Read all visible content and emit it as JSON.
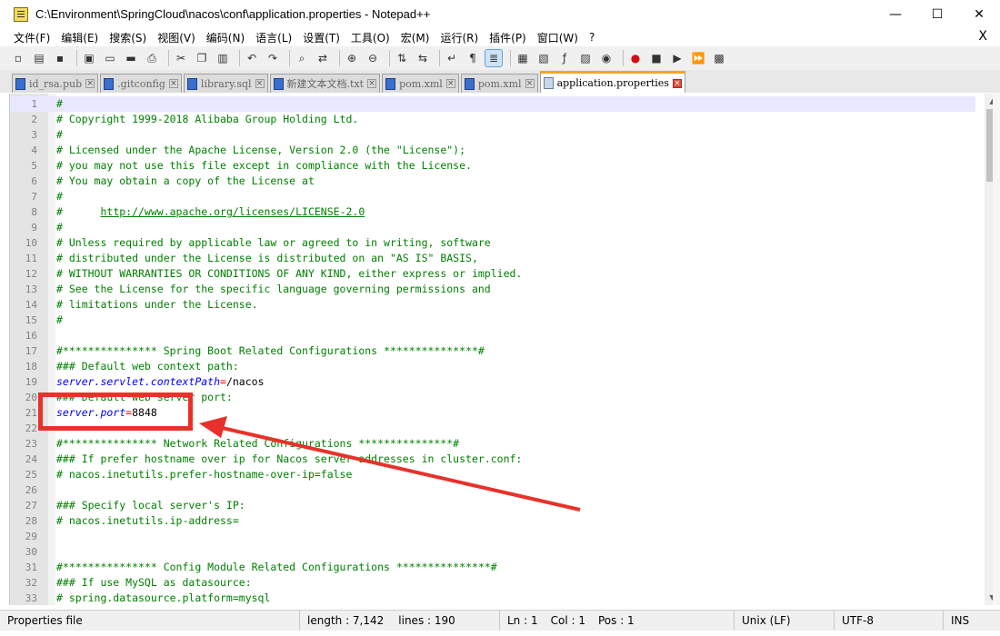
{
  "window": {
    "title": "C:\\Environment\\SpringCloud\\nacos\\conf\\application.properties - Notepad++",
    "minimize": "—",
    "maximize": "☐",
    "close": "✕"
  },
  "menu": {
    "items": [
      "文件(F)",
      "编辑(E)",
      "搜索(S)",
      "视图(V)",
      "编码(N)",
      "语言(L)",
      "设置(T)",
      "工具(O)",
      "宏(M)",
      "运行(R)",
      "插件(P)",
      "窗口(W)",
      "?"
    ],
    "close": "X"
  },
  "toolbar": {
    "buttons": [
      "new-icon",
      "open-icon",
      "save-icon",
      "save-all-icon",
      "close-icon",
      "close-all-icon",
      "print-icon",
      "cut-icon",
      "copy-icon",
      "paste-icon",
      "undo-icon",
      "redo-icon",
      "find-icon",
      "replace-icon",
      "zoom-in-icon",
      "zoom-out-icon",
      "sync-v-icon",
      "sync-h-icon",
      "wrap-icon",
      "all-chars-icon",
      "indent-guide-icon",
      "udl-icon",
      "doc-map-icon",
      "function-list-icon",
      "folder-workspace-icon",
      "monitor-icon",
      "record-macro-icon",
      "stop-macro-icon",
      "play-macro-icon",
      "play-multi-icon",
      "save-macro-icon"
    ]
  },
  "tabs": [
    {
      "label": "id_rsa.pub",
      "active": false
    },
    {
      "label": ".gitconfig",
      "active": false
    },
    {
      "label": "library.sql",
      "active": false
    },
    {
      "label": "新建文本文档.txt",
      "active": false
    },
    {
      "label": "pom.xml",
      "active": false
    },
    {
      "label": "pom.xml",
      "active": false
    },
    {
      "label": "application.properties",
      "active": true
    }
  ],
  "editor": {
    "lines": [
      {
        "n": "1",
        "segs": [
          [
            "c",
            "#"
          ]
        ]
      },
      {
        "n": "2",
        "segs": [
          [
            "c",
            "# Copyright 1999-2018 Alibaba Group Holding Ltd."
          ]
        ]
      },
      {
        "n": "3",
        "segs": [
          [
            "c",
            "#"
          ]
        ]
      },
      {
        "n": "4",
        "segs": [
          [
            "c",
            "# Licensed under the Apache License, Version 2.0 (the \"License\");"
          ]
        ]
      },
      {
        "n": "5",
        "segs": [
          [
            "c",
            "# you may not use this file except in compliance with the License."
          ]
        ]
      },
      {
        "n": "6",
        "segs": [
          [
            "c",
            "# You may obtain a copy of the License at"
          ]
        ]
      },
      {
        "n": "7",
        "segs": [
          [
            "c",
            "#"
          ]
        ]
      },
      {
        "n": "8",
        "segs": [
          [
            "c",
            "#      "
          ],
          [
            "u",
            "http://www.apache.org/licenses/LICENSE-2.0"
          ]
        ]
      },
      {
        "n": "9",
        "segs": [
          [
            "c",
            "#"
          ]
        ]
      },
      {
        "n": "10",
        "segs": [
          [
            "c",
            "# Unless required by applicable law or agreed to in writing, software"
          ]
        ]
      },
      {
        "n": "11",
        "segs": [
          [
            "c",
            "# distributed under the License is distributed on an \"AS IS\" BASIS,"
          ]
        ]
      },
      {
        "n": "12",
        "segs": [
          [
            "c",
            "# WITHOUT WARRANTIES OR CONDITIONS OF ANY KIND, either express or implied."
          ]
        ]
      },
      {
        "n": "13",
        "segs": [
          [
            "c",
            "# See the License for the specific language governing permissions and"
          ]
        ]
      },
      {
        "n": "14",
        "segs": [
          [
            "c",
            "# limitations under the License."
          ]
        ]
      },
      {
        "n": "15",
        "segs": [
          [
            "c",
            "#"
          ]
        ]
      },
      {
        "n": "16",
        "segs": []
      },
      {
        "n": "17",
        "segs": [
          [
            "c",
            "#*************** Spring Boot Related Configurations ***************#"
          ]
        ]
      },
      {
        "n": "18",
        "segs": [
          [
            "c",
            "### Default web context path:"
          ]
        ]
      },
      {
        "n": "19",
        "segs": [
          [
            "k",
            "server.servlet.contextPath"
          ],
          [
            "o",
            "="
          ],
          [
            "v",
            "/nacos"
          ]
        ]
      },
      {
        "n": "20",
        "segs": [
          [
            "c",
            "### Default web server port:"
          ]
        ]
      },
      {
        "n": "21",
        "segs": [
          [
            "k",
            "server.port"
          ],
          [
            "o",
            "="
          ],
          [
            "v",
            "8848"
          ]
        ]
      },
      {
        "n": "22",
        "segs": []
      },
      {
        "n": "23",
        "segs": [
          [
            "c",
            "#*************** Network Related Configurations ***************#"
          ]
        ]
      },
      {
        "n": "24",
        "segs": [
          [
            "c",
            "### If prefer hostname over ip for Nacos server addresses in cluster.conf:"
          ]
        ]
      },
      {
        "n": "25",
        "segs": [
          [
            "c",
            "# nacos.inetutils.prefer-hostname-over-ip=false"
          ]
        ]
      },
      {
        "n": "26",
        "segs": []
      },
      {
        "n": "27",
        "segs": [
          [
            "c",
            "### Specify local server's IP:"
          ]
        ]
      },
      {
        "n": "28",
        "segs": [
          [
            "c",
            "# nacos.inetutils.ip-address="
          ]
        ]
      },
      {
        "n": "29",
        "segs": []
      },
      {
        "n": "30",
        "segs": []
      },
      {
        "n": "31",
        "segs": [
          [
            "c",
            "#*************** Config Module Related Configurations ***************#"
          ]
        ]
      },
      {
        "n": "32",
        "segs": [
          [
            "c",
            "### If use MySQL as datasource:"
          ]
        ]
      },
      {
        "n": "33",
        "segs": [
          [
            "c",
            "# spring.datasource.platform=mysql"
          ]
        ]
      }
    ],
    "current_line": 1,
    "scroll_up": "▲",
    "scroll_down": "▼"
  },
  "status": {
    "file_type": "Properties file",
    "length": "length : 7,142",
    "lines": "lines : 190",
    "ln": "Ln : 1",
    "col": "Col : 1",
    "pos": "Pos : 1",
    "eol": "Unix (LF)",
    "encoding": "UTF-8",
    "mode": "INS"
  },
  "colors": {
    "comment": "#008000",
    "key": "#0000ff",
    "operator": "#ff0000",
    "annotation": "#e8312a",
    "active_tab_accent": "#f5a623"
  }
}
